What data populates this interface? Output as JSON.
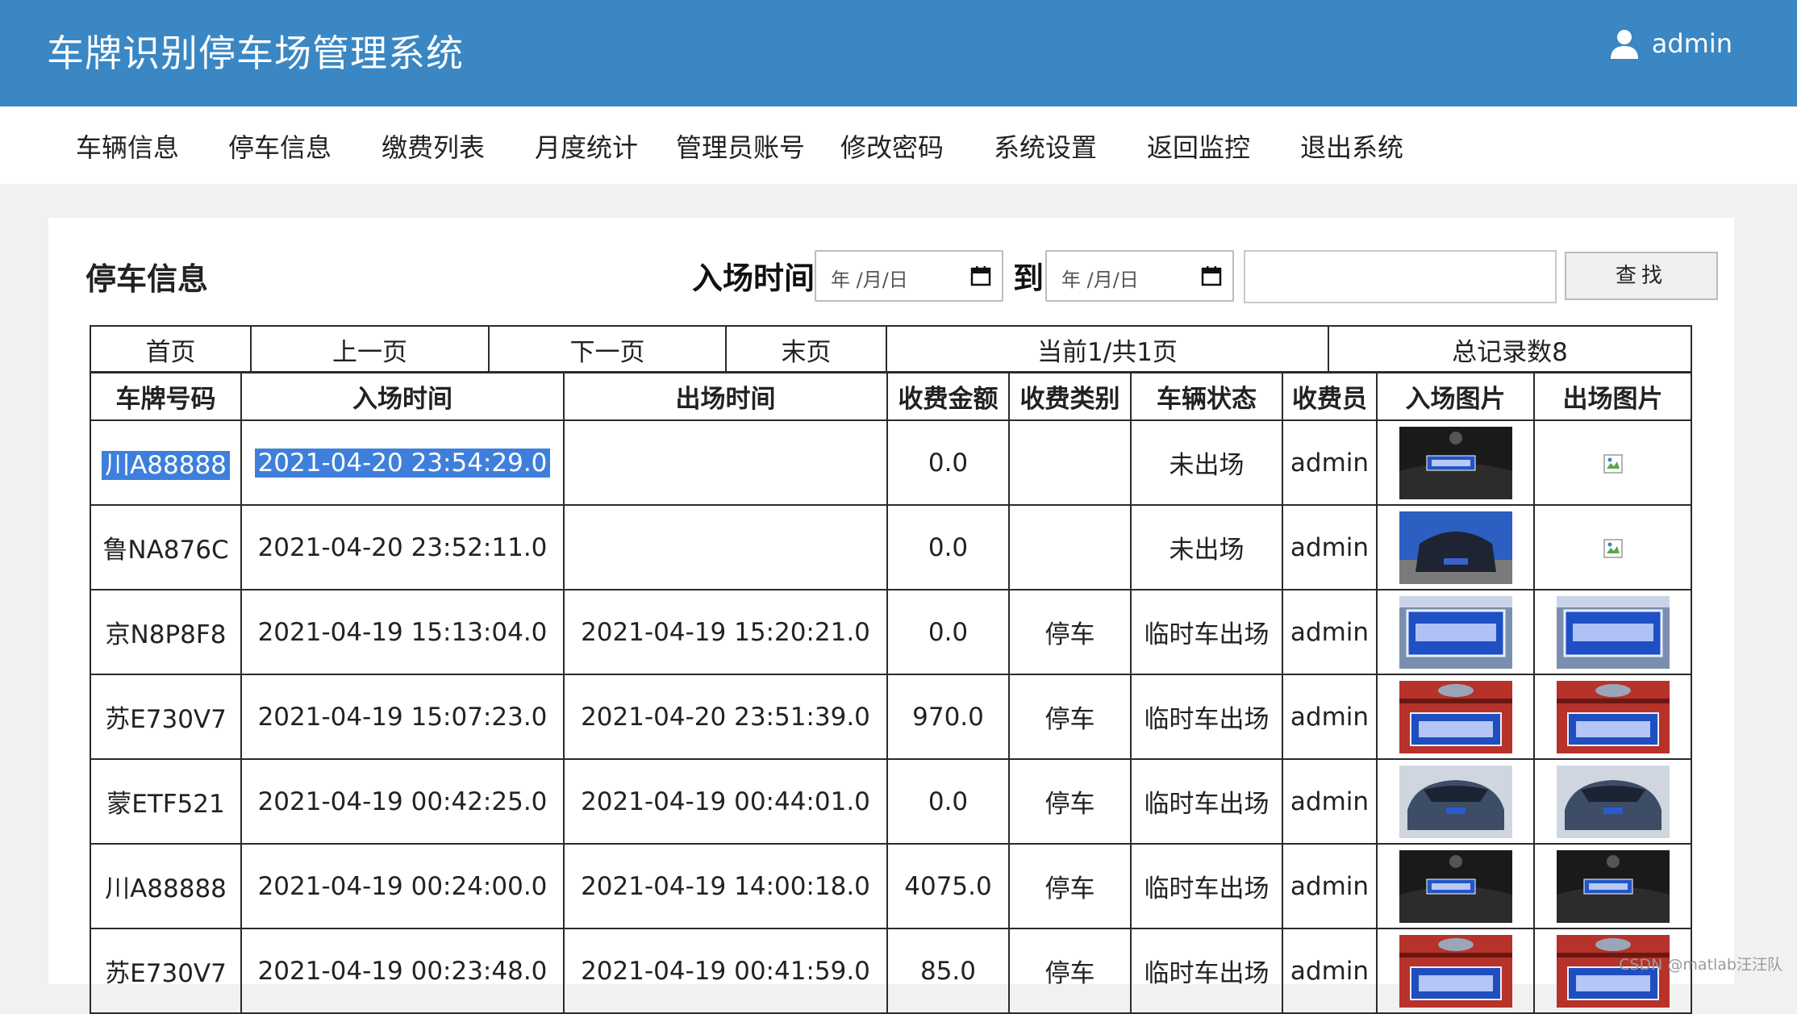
{
  "app": {
    "title": "车牌识别停车场管理系统",
    "user": "admin",
    "user_icon": "user-icon"
  },
  "nav": {
    "items": [
      "车辆信息",
      "停车信息",
      "缴费列表",
      "月度统计",
      "管理员账号",
      "修改密码",
      "系统设置",
      "返回监控",
      "退出系统"
    ]
  },
  "page": {
    "title": "停车信息"
  },
  "filter": {
    "entry_label": "入场时间",
    "to_label": "到",
    "date_placeholder": "年 /月/日",
    "search_label": "查找"
  },
  "pager": {
    "first": "首页",
    "prev": "上一页",
    "next": "下一页",
    "last": "末页",
    "current": "当前1/共1页",
    "total": "总记录数8"
  },
  "table": {
    "headers": [
      "车牌号码",
      "入场时间",
      "出场时间",
      "收费金额",
      "收费类别",
      "车辆状态",
      "收费员",
      "入场图片",
      "出场图片"
    ],
    "rows": [
      {
        "plate": "川A88888",
        "in": "2021-04-20 23:54:29.0",
        "out": "",
        "fee": "0.0",
        "type": "",
        "status": "未出场",
        "staff": "admin",
        "in_img": "plate-bmw-photo",
        "out_img": "broken-image-icon"
      },
      {
        "plate": "鲁NA876C",
        "in": "2021-04-20 23:52:11.0",
        "out": "",
        "fee": "0.0",
        "type": "",
        "status": "未出场",
        "staff": "admin",
        "in_img": "car-rear-photo",
        "out_img": "broken-image-icon"
      },
      {
        "plate": "京N8P8F8",
        "in": "2021-04-19 15:13:04.0",
        "out": "2021-04-19 15:20:21.0",
        "fee": "0.0",
        "type": "停车",
        "status": "临时车出场",
        "staff": "admin",
        "in_img": "plate-blue-photo",
        "out_img": "plate-blue-photo"
      },
      {
        "plate": "苏E730V7",
        "in": "2021-04-19 15:07:23.0",
        "out": "2021-04-20 23:51:39.0",
        "fee": "970.0",
        "type": "停车",
        "status": "临时车出场",
        "staff": "admin",
        "in_img": "plate-red-car-photo",
        "out_img": "plate-red-car-photo"
      },
      {
        "plate": "蒙ETF521",
        "in": "2021-04-19 00:42:25.0",
        "out": "2021-04-19 00:44:01.0",
        "fee": "0.0",
        "type": "停车",
        "status": "临时车出场",
        "staff": "admin",
        "in_img": "car-front-photo",
        "out_img": "car-front-photo"
      },
      {
        "plate": "川A88888",
        "in": "2021-04-19 00:24:00.0",
        "out": "2021-04-19 14:00:18.0",
        "fee": "4075.0",
        "type": "停车",
        "status": "临时车出场",
        "staff": "admin",
        "in_img": "plate-bmw-photo",
        "out_img": "plate-bmw-photo"
      },
      {
        "plate": "苏E730V7",
        "in": "2021-04-19 00:23:48.0",
        "out": "2021-04-19 00:41:59.0",
        "fee": "85.0",
        "type": "停车",
        "status": "临时车出场",
        "staff": "admin",
        "in_img": "plate-red-car-photo",
        "out_img": "plate-red-car-photo"
      }
    ]
  },
  "watermark": "CSDN @matlab汪汪队",
  "colors": {
    "header_bg": "#3a87c3",
    "selection": "#3f7fdc"
  }
}
